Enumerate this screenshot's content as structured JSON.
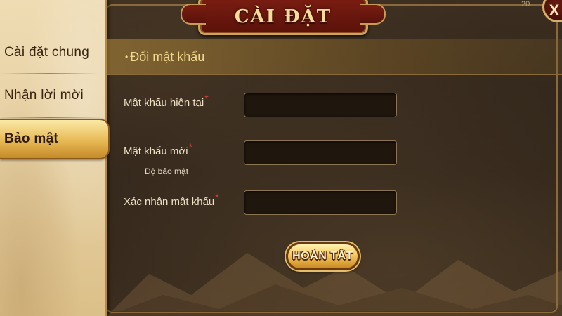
{
  "dialog": {
    "title": "CÀI ĐẶT",
    "close_label": "X",
    "corner_text": "20"
  },
  "sidebar": {
    "items": [
      {
        "label": "Cài đặt chung",
        "active": false
      },
      {
        "label": "Nhận lời mời",
        "active": false
      },
      {
        "label": "Bảo mật",
        "active": true
      }
    ]
  },
  "section": {
    "bullet": "•",
    "title": "Đổi mật khẩu"
  },
  "form": {
    "required_mark": "*",
    "current_password": {
      "label": "Mật khẩu hiện tại",
      "value": ""
    },
    "new_password": {
      "label": "Mật khẩu mới",
      "value": "",
      "strength_label": "Độ bảo mật"
    },
    "confirm_password": {
      "label": "Xác nhận mật khẩu",
      "value": ""
    },
    "submit_label": "HOÀN TẤT"
  },
  "colors": {
    "accent_gold": "#f3d98f",
    "title_red": "#7a1d12",
    "required_red": "#e03a2a",
    "sidebar_bg": "#e6cfa1"
  }
}
